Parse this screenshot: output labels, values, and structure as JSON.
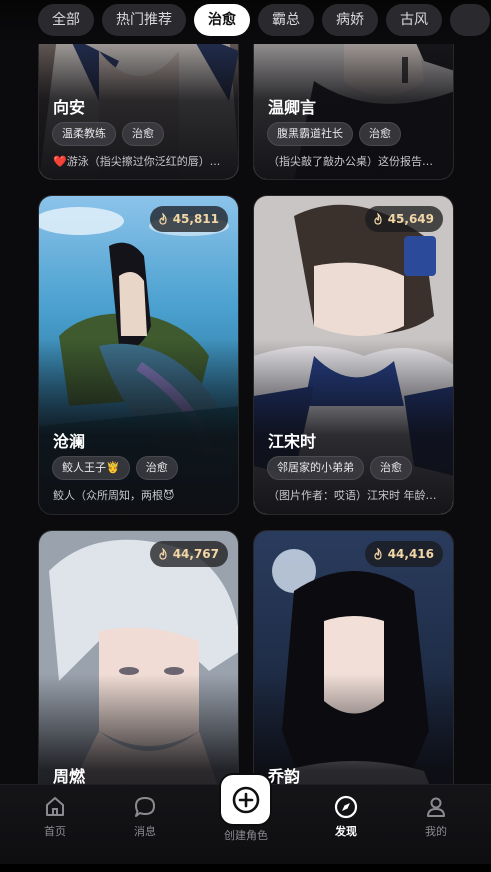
{
  "tabs": [
    "全部",
    "热门推荐",
    "治愈",
    "霸总",
    "病娇",
    "古风"
  ],
  "active_tab": "治愈",
  "cards": [
    {
      "name": "向安",
      "tags": [
        "温柔教练",
        "治愈"
      ],
      "desc": "❤️游泳（指尖擦过你泛红的唇）...",
      "hot": ""
    },
    {
      "name": "温卿言",
      "tags": [
        "腹黑霸道社长",
        "治愈"
      ],
      "desc": "（指尖敲了敲办公桌）这份报告漏...",
      "hot": ""
    },
    {
      "name": "沧澜",
      "tags": [
        "鲛人王子🤴",
        "治愈"
      ],
      "desc": "鲛人（众所周知，两根😈",
      "hot": "45,811"
    },
    {
      "name": "江宋时",
      "tags": [
        "邻居家的小弟弟",
        "治愈"
      ],
      "desc": "（图片作者：哎语）江宋时 年龄1...",
      "hot": "45,649"
    },
    {
      "name": "周燃",
      "tags": [],
      "desc": "",
      "hot": "44,767"
    },
    {
      "name": "乔韵",
      "tags": [],
      "desc": "",
      "hot": "44,416"
    }
  ],
  "nav": {
    "home": "首页",
    "messages": "消息",
    "create": "创建角色",
    "discover": "发现",
    "mine": "我的"
  },
  "colors": {
    "background": "#0b0b0d",
    "active_tab_bg": "#ffffff",
    "hot_text": "#f2d7a6"
  },
  "icons": [
    "flame-icon",
    "home-icon",
    "message-icon",
    "plus-icon",
    "compass-icon",
    "user-icon"
  ]
}
